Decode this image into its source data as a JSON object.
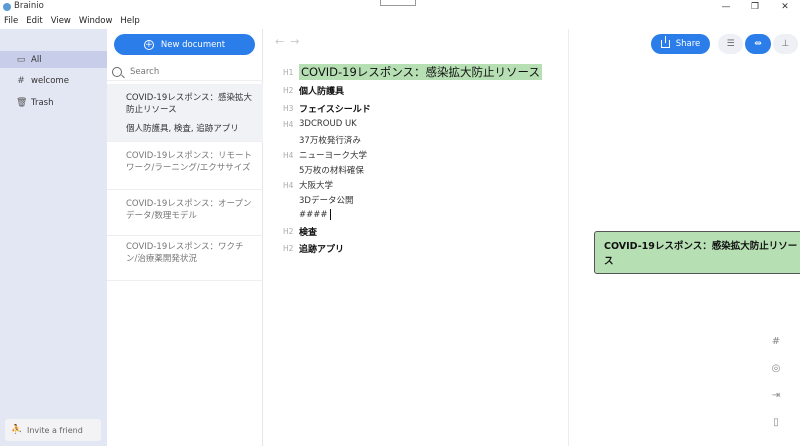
{
  "window": {
    "title": "Brainio",
    "controls": [
      "—",
      "❐",
      "✕"
    ]
  },
  "menu": [
    "File",
    "Edit",
    "View",
    "Window",
    "Help"
  ],
  "nav": {
    "items": [
      {
        "label": "All",
        "icon": "folder-icon",
        "active": true
      },
      {
        "label": "welcome",
        "icon": "hash-icon",
        "active": false
      },
      {
        "label": "Trash",
        "icon": "trash-icon",
        "active": false
      }
    ],
    "invite_label": "Invite a friend"
  },
  "doclist": {
    "new_document_label": "New document",
    "search_placeholder": "Search",
    "documents": [
      {
        "title": "COVID-19レスポンス：感染拡大防止リソース",
        "subtitle": "個人防護具, 検査, 追跡アプリ",
        "selected": true
      },
      {
        "title": "COVID-19レスポンス：リモートワーク/ラーニング/エクササイズ",
        "subtitle": "",
        "selected": false
      },
      {
        "title": "COVID-19レスポンス：オープンデータ/数理モデル",
        "subtitle": "",
        "selected": false
      },
      {
        "title": "COVID-19レスポンス：ワクチン/治療薬開発状況",
        "subtitle": "",
        "selected": false
      }
    ]
  },
  "editor": {
    "back_arrow": "←",
    "forward_arrow": "→",
    "lines": [
      {
        "tag": "H1",
        "text": "COVID-19レスポンス：感染拡大防止リソース",
        "level": "h1"
      },
      {
        "tag": "H2",
        "text": "個人防護具",
        "level": "h2"
      },
      {
        "tag": "H3",
        "text": "フェイスシールド",
        "level": "h3"
      },
      {
        "tag": "H4",
        "text": "3DCROUD UK",
        "level": "h4"
      },
      {
        "tag": "",
        "text": "37万枚発行済み",
        "level": "p"
      },
      {
        "tag": "H4",
        "text": "ニューヨーク大学",
        "level": "h4"
      },
      {
        "tag": "",
        "text": "5万枚の材料確保",
        "level": "p"
      },
      {
        "tag": "H4",
        "text": "大阪大学",
        "level": "h4"
      },
      {
        "tag": "",
        "text": "3Dデータ公開",
        "level": "p"
      },
      {
        "tag": "",
        "text": "####",
        "level": "p"
      },
      {
        "tag": "H2",
        "text": "検査",
        "level": "h2"
      },
      {
        "tag": "H2",
        "text": "追跡アプリ",
        "level": "h2"
      }
    ]
  },
  "mindmap": {
    "share_label": "Share",
    "view_buttons": [
      "list-view-icon",
      "mindmap-view-icon",
      "split-view-icon"
    ],
    "root_node_text": "COVID-19レスポンス：感染拡大防止リソース",
    "side_tools": [
      "hash-tool-icon",
      "focus-tool-icon",
      "export-tool-icon",
      "panel-tool-icon"
    ]
  },
  "colors": {
    "accent": "#2b7de9",
    "nav_bg": "#e3e6f3",
    "highlight_green": "#b7dfb4"
  }
}
